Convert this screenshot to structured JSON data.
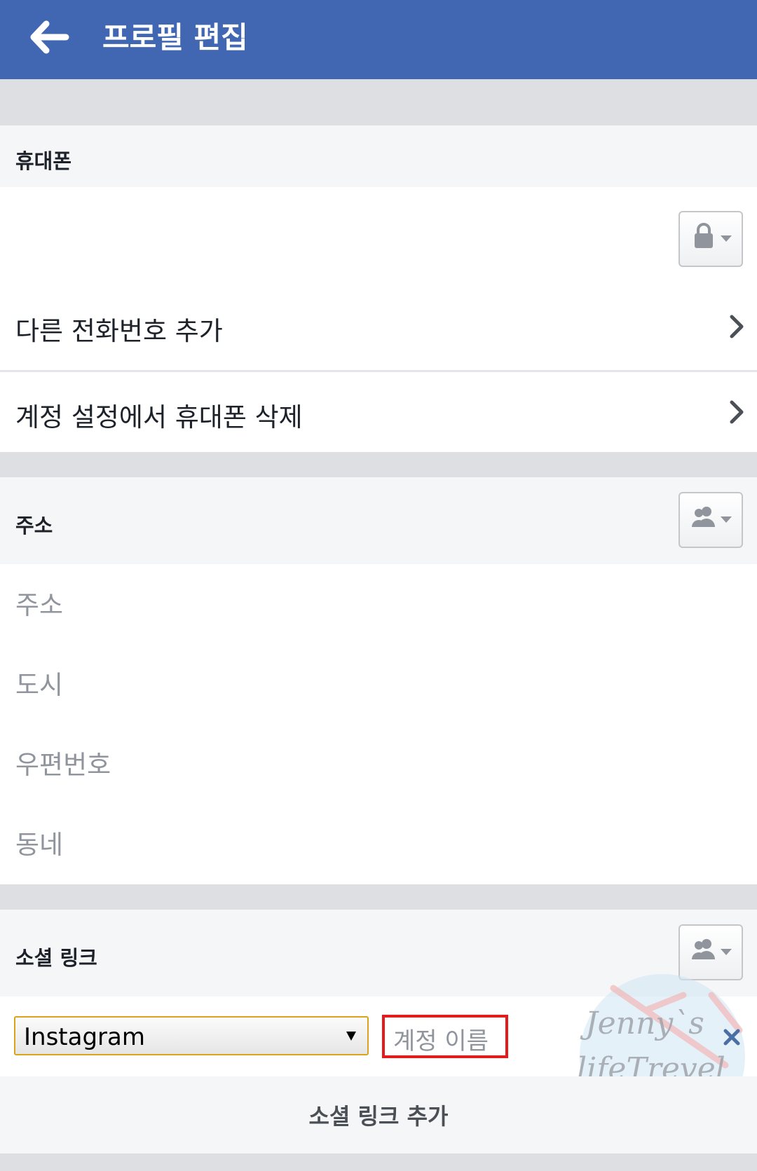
{
  "header": {
    "title": "프로필 편집",
    "back_icon": "arrow-left-icon",
    "background": "#4267b2"
  },
  "phone": {
    "section_label": "휴대폰",
    "privacy_icon": "lock-icon",
    "rows": [
      {
        "label": "다른 전화번호 추가"
      },
      {
        "label": "계정 설정에서 휴대폰 삭제"
      }
    ]
  },
  "address": {
    "section_label": "주소",
    "privacy_icon": "friends-icon",
    "fields": [
      {
        "placeholder": "주소"
      },
      {
        "placeholder": "도시"
      },
      {
        "placeholder": "우편번호"
      },
      {
        "placeholder": "동네"
      }
    ]
  },
  "social": {
    "section_label": "소셜 링크",
    "privacy_icon": "friends-icon",
    "network_select": {
      "selected": "Instagram"
    },
    "account_input": {
      "placeholder": "계정 이름"
    },
    "add_label": "소셜 링크 추가"
  },
  "watermark": {
    "line1": "Jenny`s",
    "line2": "lifeTrevel"
  },
  "colors": {
    "accent": "#4267b2",
    "highlight": "#e41b1b",
    "select_border": "#d9a31a"
  }
}
